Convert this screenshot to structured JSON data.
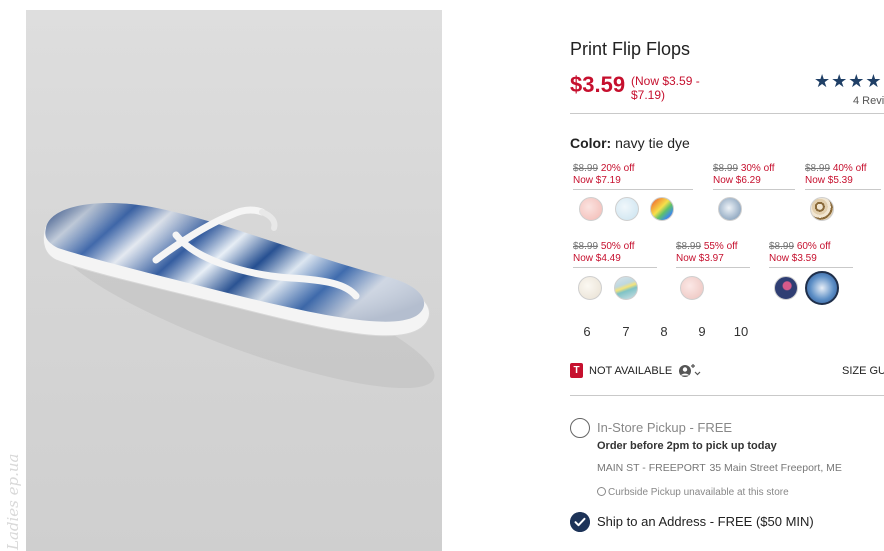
{
  "watermark": "Ladies ep.ua",
  "product": {
    "title": "Print Flip Flops",
    "price": "$3.59",
    "price_range": "(Now $3.59 - $7.19)",
    "stars": "★★★★",
    "reviews": "4 Revi",
    "rating_color": "#1f3f66",
    "sale_color": "#c6102e"
  },
  "color": {
    "label": "Color:",
    "value": "navy tie dye"
  },
  "price_groups": [
    {
      "was": "$8.99",
      "off": "20% off",
      "now": "Now $7.19",
      "swatches": [
        "pink-marble",
        "light-blue-marble",
        "rainbow"
      ]
    },
    {
      "was": "$8.99",
      "off": "30% off",
      "now": "Now $6.29",
      "swatches": [
        "blue-gray-tie-dye"
      ]
    },
    {
      "was": "$8.99",
      "off": "40% off",
      "now": "Now $5.39",
      "swatches": [
        "leopard"
      ]
    },
    {
      "was": "$8.99",
      "off": "50% off",
      "now": "Now $4.49",
      "swatches": [
        "cream",
        "teal-stripe"
      ]
    },
    {
      "was": "$8.99",
      "off": "55% off",
      "now": "Now $3.97",
      "swatches": [
        "blush"
      ]
    },
    {
      "was": "$8.99",
      "off": "60% off",
      "now": "Now $3.59",
      "swatches": [
        "navy-floral",
        "navy-tie-dye"
      ]
    }
  ],
  "selected_swatch": "navy-tie-dye",
  "sizes": [
    "6",
    "7",
    "8",
    "9",
    "10"
  ],
  "availability": {
    "badge": "T",
    "text": "NOT AVAILABLE",
    "size_guide": "SIZE GU"
  },
  "pickup": {
    "label": "In-Store Pickup - FREE",
    "note": "Order before 2pm to pick up today",
    "store": "MAIN ST - FREEPORT",
    "address": "35 Main Street  Freeport, ME",
    "curbside": "Curbside Pickup unavailable at this store"
  },
  "ship": {
    "label": "Ship to an Address - FREE ($50 MIN)"
  }
}
